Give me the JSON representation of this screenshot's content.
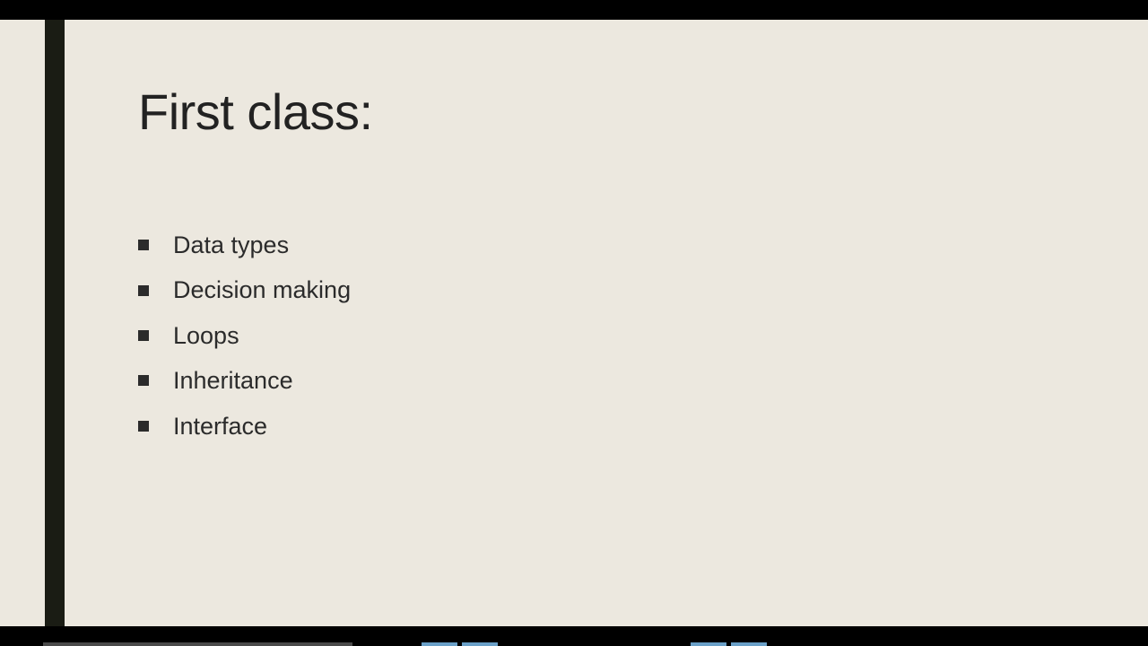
{
  "slide": {
    "title": "First class:",
    "bullets": [
      "Data types",
      "Decision making",
      "Loops",
      "Inheritance",
      "Interface"
    ]
  }
}
